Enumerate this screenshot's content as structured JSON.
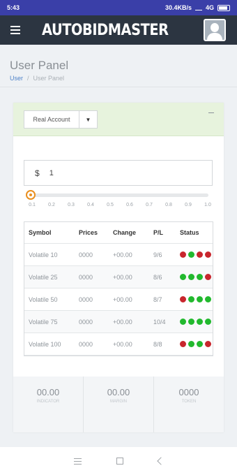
{
  "statusbar": {
    "time": "5:43",
    "network": "30.4KB/s",
    "signal": "4G"
  },
  "header": {
    "logo": "AUTOBIDMASTER"
  },
  "page": {
    "title": "User Panel",
    "breadcrumb": {
      "link": "User",
      "separator": "/",
      "current": "User Panel"
    }
  },
  "card": {
    "account_select": "Real Account",
    "amount": {
      "currency": "$",
      "value": "1"
    },
    "slider": {
      "value": 0.1,
      "ticks": [
        "0.1",
        "0.2",
        "0.3",
        "0.4",
        "0.5",
        "0.6",
        "0.7",
        "0.8",
        "0.9",
        "1.0"
      ]
    },
    "table": {
      "headers": {
        "symbol": "Symbol",
        "prices": "Prices",
        "change": "Change",
        "pl": "P/L",
        "status": "Status"
      },
      "rows": [
        {
          "symbol": "Volatile 10",
          "prices": "0000",
          "change": "+00.00",
          "pl": "9/6",
          "status": [
            "red",
            "green",
            "red",
            "red"
          ]
        },
        {
          "symbol": "Volatile 25",
          "prices": "0000",
          "change": "+00.00",
          "pl": "8/6",
          "status": [
            "green",
            "green",
            "green",
            "red"
          ]
        },
        {
          "symbol": "Volatile 50",
          "prices": "0000",
          "change": "+00.00",
          "pl": "8/7",
          "status": [
            "red",
            "green",
            "green",
            "green"
          ]
        },
        {
          "symbol": "Volatile 75",
          "prices": "0000",
          "change": "+00.00",
          "pl": "10/4",
          "status": [
            "green",
            "green",
            "green",
            "green"
          ]
        },
        {
          "symbol": "Volatile 100",
          "prices": "0000",
          "change": "+00.00",
          "pl": "8/8",
          "status": [
            "red",
            "green",
            "green",
            "red"
          ]
        }
      ]
    },
    "stats": [
      {
        "value": "00.00",
        "label": "INDICATOR"
      },
      {
        "value": "00.00",
        "label": "MARGIN"
      },
      {
        "value": "0000",
        "label": "TOKEN"
      }
    ]
  },
  "colors": {
    "red": "#c8262d",
    "green": "#22b92e",
    "accent": "#e98f1f",
    "header_bg": "#2c3541"
  }
}
